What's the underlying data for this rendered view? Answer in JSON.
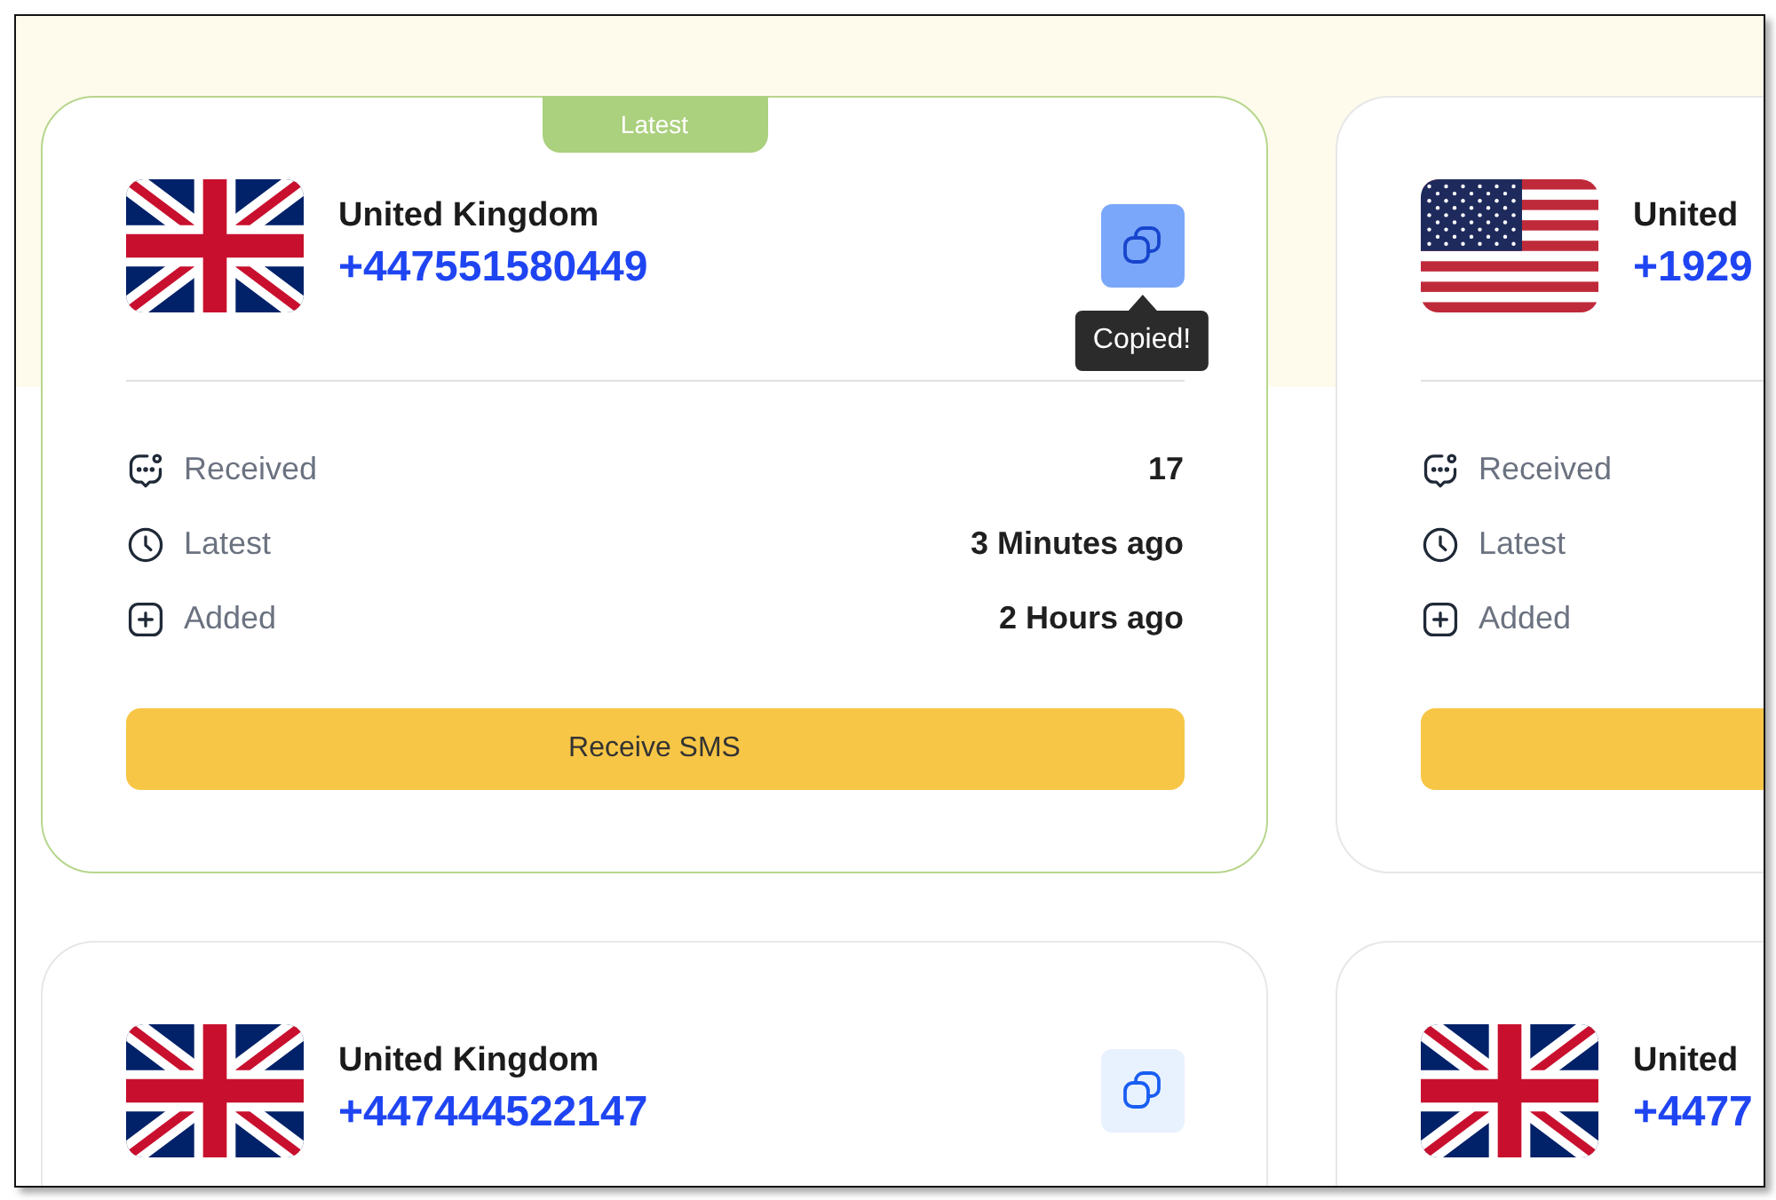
{
  "cards": [
    {
      "badge": "Latest",
      "highlighted": true,
      "flag": {
        "kind": "uk"
      },
      "country": "United Kingdom",
      "phone": "+447551580449",
      "copy_button": {
        "copied": true,
        "tooltip": "Copied!"
      },
      "stats": [
        {
          "kind": "received",
          "label": "Received",
          "value": "17"
        },
        {
          "kind": "latest",
          "label": "Latest",
          "value": "3 Minutes ago"
        },
        {
          "kind": "added",
          "label": "Added",
          "value": "2 Hours ago"
        }
      ],
      "receive_button": {
        "shown": true,
        "label": "Receive SMS"
      }
    },
    {
      "highlighted": false,
      "flag": {
        "kind": "us"
      },
      "country": "United",
      "phone": "+1929",
      "stats": [
        {
          "kind": "received",
          "label": "Received"
        },
        {
          "kind": "latest",
          "label": "Latest"
        },
        {
          "kind": "added",
          "label": "Added"
        }
      ],
      "receive_button": {
        "shown": true
      }
    },
    {
      "highlighted": false,
      "flag": {
        "kind": "uk"
      },
      "country": "United Kingdom",
      "phone": "+447444522147",
      "copy_button": {
        "copied": false
      }
    },
    {
      "highlighted": false,
      "flag": {
        "kind": "uk"
      },
      "country": "United",
      "phone": "+4477"
    }
  ]
}
